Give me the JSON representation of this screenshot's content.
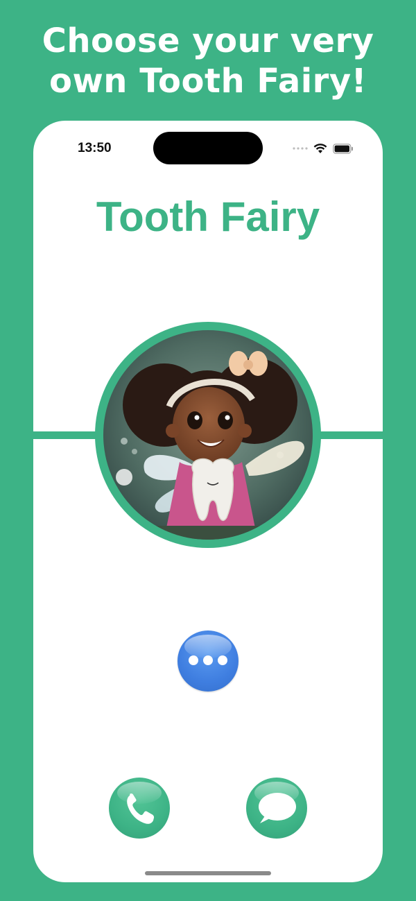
{
  "promo": {
    "headline_line1": "Choose your very",
    "headline_line2": "own Tooth Fairy!"
  },
  "status_bar": {
    "time": "13:50",
    "icons": [
      "signal-icon",
      "wifi-icon",
      "battery-icon"
    ]
  },
  "screen": {
    "title": "Tooth Fairy",
    "avatar_description": "fairy-avatar",
    "buttons": {
      "more": "more-options-icon",
      "call": "phone-icon",
      "message": "message-bubble-icon"
    }
  },
  "colors": {
    "brand_green": "#3db386",
    "more_blue": "#3f7ee0",
    "background_white": "#ffffff"
  }
}
